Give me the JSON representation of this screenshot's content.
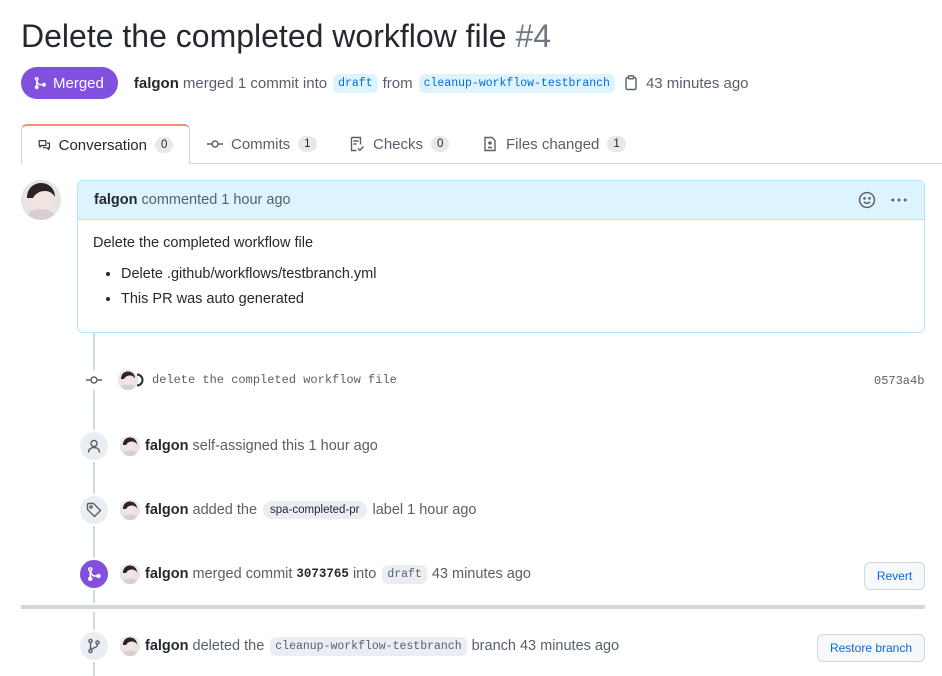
{
  "pr": {
    "title": "Delete the completed workflow file",
    "number": "#4",
    "status": "Merged",
    "author": "falgon",
    "merged_text": "merged 1 commit into",
    "base_branch": "draft",
    "from_text": "from",
    "head_branch": "cleanup-workflow-testbranch",
    "time": "43 minutes ago"
  },
  "tabs": [
    {
      "label": "Conversation",
      "count": "0"
    },
    {
      "label": "Commits",
      "count": "1"
    },
    {
      "label": "Checks",
      "count": "0"
    },
    {
      "label": "Files changed",
      "count": "1"
    }
  ],
  "comment": {
    "author": "falgon",
    "action": "commented",
    "time": "1 hour ago",
    "body_title": "Delete the completed workflow file",
    "items": [
      "Delete .github/workflows/testbranch.yml",
      "This PR was auto generated"
    ]
  },
  "timeline": {
    "commit": {
      "message": "delete the completed workflow file",
      "sha": "0573a4b"
    },
    "assign": {
      "user": "falgon",
      "text": "self-assigned this",
      "time": "1 hour ago"
    },
    "label": {
      "user": "falgon",
      "text": "added the",
      "label": "spa-completed-pr",
      "suffix": "label",
      "time": "1 hour ago"
    },
    "merge": {
      "user": "falgon",
      "text": "merged commit",
      "sha": "3073765",
      "into": "into",
      "branch": "draft",
      "time": "43 minutes ago",
      "button": "Revert"
    },
    "delete": {
      "user": "falgon",
      "text": "deleted the",
      "branch": "cleanup-workflow-testbranch",
      "suffix": "branch",
      "time": "43 minutes ago",
      "button": "Restore branch"
    }
  },
  "colors": {
    "merged": "#8250df",
    "link": "#0969da",
    "tab_accent": "#fd8c73"
  }
}
